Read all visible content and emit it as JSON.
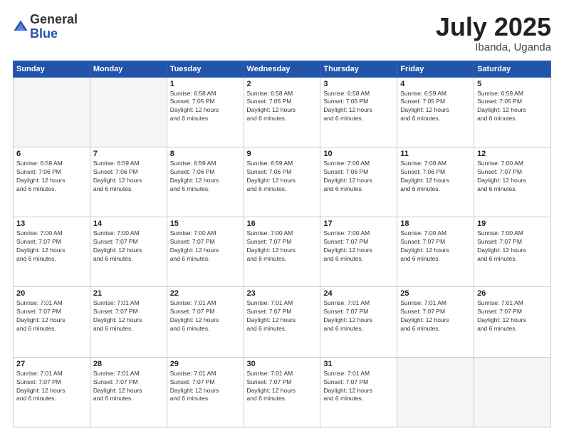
{
  "header": {
    "logo_general": "General",
    "logo_blue": "Blue",
    "month": "July 2025",
    "location": "Ibanda, Uganda"
  },
  "days_of_week": [
    "Sunday",
    "Monday",
    "Tuesday",
    "Wednesday",
    "Thursday",
    "Friday",
    "Saturday"
  ],
  "weeks": [
    [
      {
        "day": "",
        "info": ""
      },
      {
        "day": "",
        "info": ""
      },
      {
        "day": "1",
        "info": "Sunrise: 6:58 AM\nSunset: 7:05 PM\nDaylight: 12 hours\nand 6 minutes."
      },
      {
        "day": "2",
        "info": "Sunrise: 6:58 AM\nSunset: 7:05 PM\nDaylight: 12 hours\nand 6 minutes."
      },
      {
        "day": "3",
        "info": "Sunrise: 6:58 AM\nSunset: 7:05 PM\nDaylight: 12 hours\nand 6 minutes."
      },
      {
        "day": "4",
        "info": "Sunrise: 6:59 AM\nSunset: 7:05 PM\nDaylight: 12 hours\nand 6 minutes."
      },
      {
        "day": "5",
        "info": "Sunrise: 6:59 AM\nSunset: 7:05 PM\nDaylight: 12 hours\nand 6 minutes."
      }
    ],
    [
      {
        "day": "6",
        "info": "Sunrise: 6:59 AM\nSunset: 7:06 PM\nDaylight: 12 hours\nand 6 minutes."
      },
      {
        "day": "7",
        "info": "Sunrise: 6:59 AM\nSunset: 7:06 PM\nDaylight: 12 hours\nand 6 minutes."
      },
      {
        "day": "8",
        "info": "Sunrise: 6:59 AM\nSunset: 7:06 PM\nDaylight: 12 hours\nand 6 minutes."
      },
      {
        "day": "9",
        "info": "Sunrise: 6:59 AM\nSunset: 7:06 PM\nDaylight: 12 hours\nand 6 minutes."
      },
      {
        "day": "10",
        "info": "Sunrise: 7:00 AM\nSunset: 7:06 PM\nDaylight: 12 hours\nand 6 minutes."
      },
      {
        "day": "11",
        "info": "Sunrise: 7:00 AM\nSunset: 7:06 PM\nDaylight: 12 hours\nand 6 minutes."
      },
      {
        "day": "12",
        "info": "Sunrise: 7:00 AM\nSunset: 7:07 PM\nDaylight: 12 hours\nand 6 minutes."
      }
    ],
    [
      {
        "day": "13",
        "info": "Sunrise: 7:00 AM\nSunset: 7:07 PM\nDaylight: 12 hours\nand 6 minutes."
      },
      {
        "day": "14",
        "info": "Sunrise: 7:00 AM\nSunset: 7:07 PM\nDaylight: 12 hours\nand 6 minutes."
      },
      {
        "day": "15",
        "info": "Sunrise: 7:00 AM\nSunset: 7:07 PM\nDaylight: 12 hours\nand 6 minutes."
      },
      {
        "day": "16",
        "info": "Sunrise: 7:00 AM\nSunset: 7:07 PM\nDaylight: 12 hours\nand 6 minutes."
      },
      {
        "day": "17",
        "info": "Sunrise: 7:00 AM\nSunset: 7:07 PM\nDaylight: 12 hours\nand 6 minutes."
      },
      {
        "day": "18",
        "info": "Sunrise: 7:00 AM\nSunset: 7:07 PM\nDaylight: 12 hours\nand 6 minutes."
      },
      {
        "day": "19",
        "info": "Sunrise: 7:00 AM\nSunset: 7:07 PM\nDaylight: 12 hours\nand 6 minutes."
      }
    ],
    [
      {
        "day": "20",
        "info": "Sunrise: 7:01 AM\nSunset: 7:07 PM\nDaylight: 12 hours\nand 6 minutes."
      },
      {
        "day": "21",
        "info": "Sunrise: 7:01 AM\nSunset: 7:07 PM\nDaylight: 12 hours\nand 6 minutes."
      },
      {
        "day": "22",
        "info": "Sunrise: 7:01 AM\nSunset: 7:07 PM\nDaylight: 12 hours\nand 6 minutes."
      },
      {
        "day": "23",
        "info": "Sunrise: 7:01 AM\nSunset: 7:07 PM\nDaylight: 12 hours\nand 6 minutes."
      },
      {
        "day": "24",
        "info": "Sunrise: 7:01 AM\nSunset: 7:07 PM\nDaylight: 12 hours\nand 6 minutes."
      },
      {
        "day": "25",
        "info": "Sunrise: 7:01 AM\nSunset: 7:07 PM\nDaylight: 12 hours\nand 6 minutes."
      },
      {
        "day": "26",
        "info": "Sunrise: 7:01 AM\nSunset: 7:07 PM\nDaylight: 12 hours\nand 6 minutes."
      }
    ],
    [
      {
        "day": "27",
        "info": "Sunrise: 7:01 AM\nSunset: 7:07 PM\nDaylight: 12 hours\nand 6 minutes."
      },
      {
        "day": "28",
        "info": "Sunrise: 7:01 AM\nSunset: 7:07 PM\nDaylight: 12 hours\nand 6 minutes."
      },
      {
        "day": "29",
        "info": "Sunrise: 7:01 AM\nSunset: 7:07 PM\nDaylight: 12 hours\nand 6 minutes."
      },
      {
        "day": "30",
        "info": "Sunrise: 7:01 AM\nSunset: 7:07 PM\nDaylight: 12 hours\nand 6 minutes."
      },
      {
        "day": "31",
        "info": "Sunrise: 7:01 AM\nSunset: 7:07 PM\nDaylight: 12 hours\nand 6 minutes."
      },
      {
        "day": "",
        "info": ""
      },
      {
        "day": "",
        "info": ""
      }
    ]
  ]
}
